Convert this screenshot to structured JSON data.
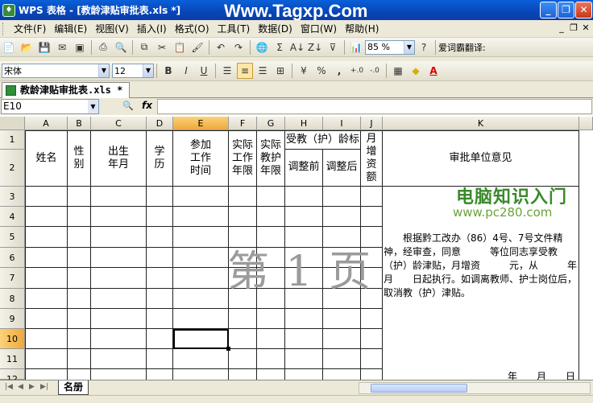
{
  "window": {
    "title": "WPS 表格 - [教龄津贴审批表.xls *]",
    "watermark": "Www.Tagxp.Com",
    "minimize": "_",
    "restore": "❐",
    "close": "✕"
  },
  "menu": [
    "文件(F)",
    "编辑(E)",
    "视图(V)",
    "插入(I)",
    "格式(O)",
    "工具(T)",
    "数据(D)",
    "窗口(W)",
    "帮助(H)"
  ],
  "toolbar": {
    "zoom": "85 %",
    "translate_label": "爱词霸翻译:"
  },
  "format_toolbar": {
    "font": "宋体",
    "size": "12",
    "bold": "B",
    "italic": "I",
    "underline": "U",
    "percent": "%",
    "comma": ","
  },
  "doc_tab": "教龄津贴审批表.xls *",
  "formula_bar": {
    "cell_ref": "E10",
    "fx": "fx"
  },
  "grid": {
    "columns": [
      "A",
      "B",
      "C",
      "D",
      "E",
      "F",
      "G",
      "H",
      "I",
      "J",
      "K"
    ],
    "selected_column": "E",
    "rows": [
      "1",
      "2",
      "3",
      "4",
      "5",
      "6",
      "7",
      "8",
      "9",
      "10",
      "11",
      "12"
    ],
    "selected_row": "10",
    "headers": {
      "name": "姓名",
      "gender": "性别",
      "birth": "出生年月",
      "education": "学历",
      "join_time": "参加工作时间",
      "work_years": "实际工作年限",
      "teach_years": "实际教护年限",
      "allowance": "受教（护）龄标",
      "before": "调整前",
      "after": "调整后",
      "monthly": "月增资额",
      "approval": "审批单位意见"
    },
    "approval_text": "根据黔工改办（86）4号、7号文件精神，经审查，同意　　　等位同志享受教（护）龄津贴，月增资　　　元，从　　　年　　月　　日起执行。如调离教师、护士岗位后，取消教（护）津贴。",
    "date_line": "年　　月　　日",
    "page_watermark": "第 1 页",
    "logo_cn": "电脑知识入门",
    "logo_url": "www.pc280.com"
  },
  "sheet_tab": "名册"
}
